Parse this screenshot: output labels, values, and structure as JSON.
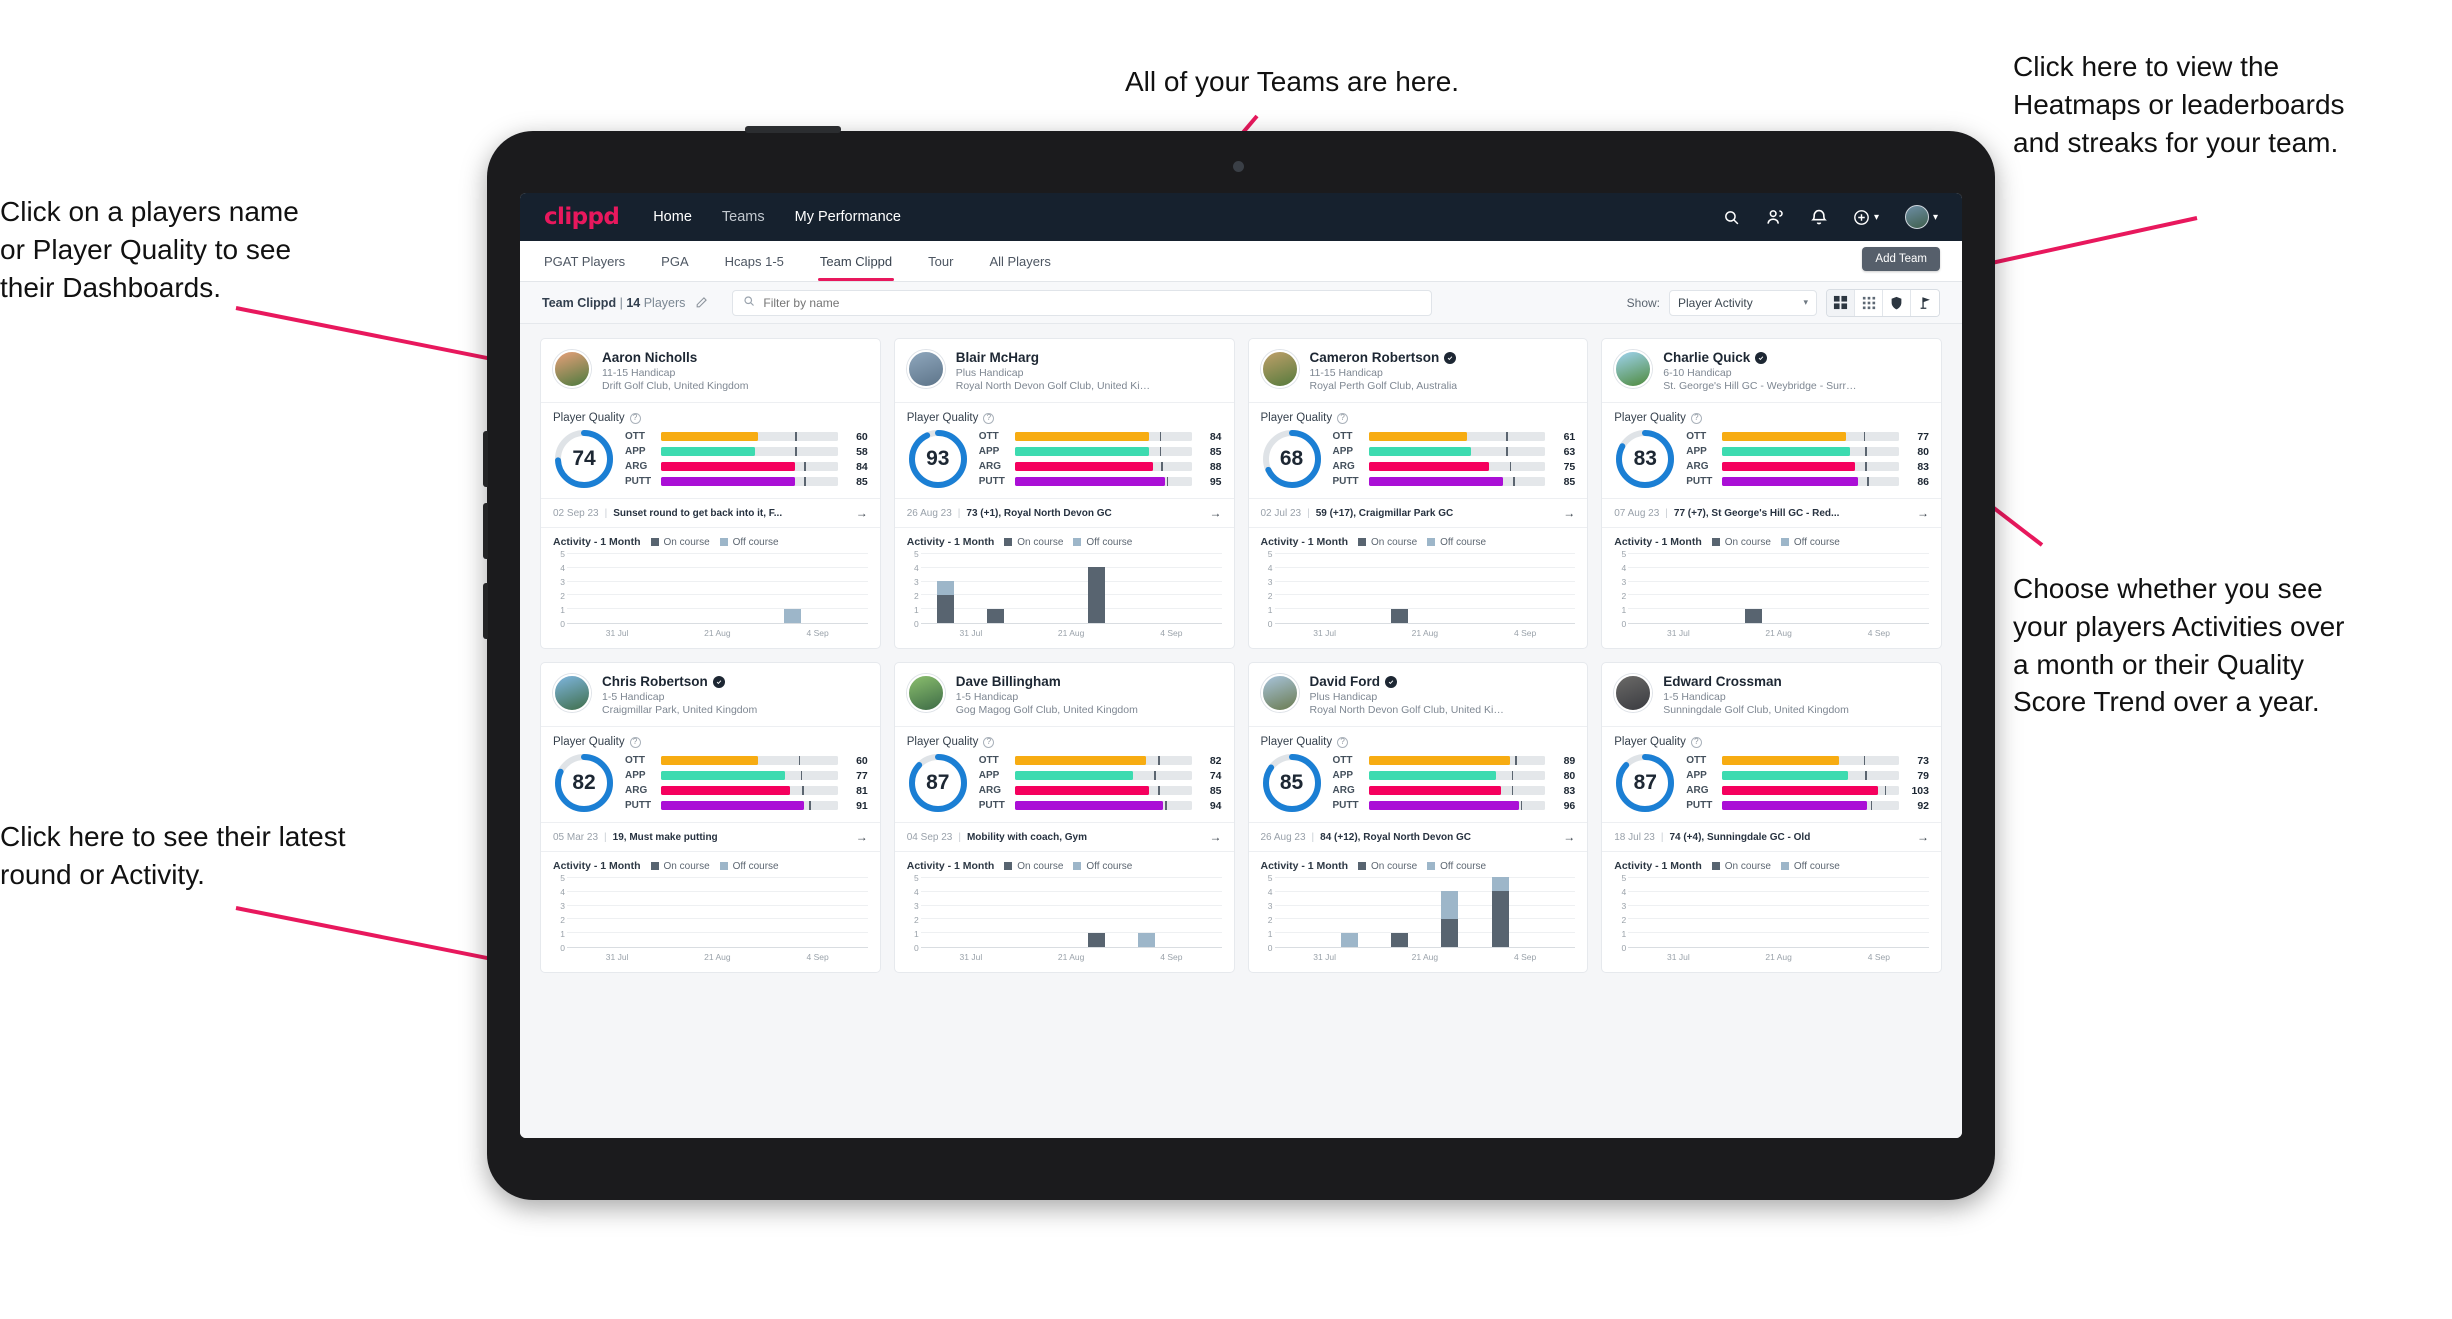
{
  "annotations": [
    {
      "id": "a-players",
      "text": "Click on a players name\nor Player Quality to see\ntheir Dashboards."
    },
    {
      "id": "a-teams",
      "text": "All of your Teams are here."
    },
    {
      "id": "a-heatmaps",
      "text": "Click here to view the\nHeatmaps or leaderboards\nand streaks for your team."
    },
    {
      "id": "a-activity",
      "text": "Choose whether you see\nyour players Activities over\na month or their Quality\nScore Trend over a year."
    },
    {
      "id": "a-latest",
      "text": "Click here to see their latest\nround or Activity."
    }
  ],
  "app": {
    "logo": "clippd",
    "nav": [
      {
        "label": "Home",
        "active": true
      },
      {
        "label": "Teams",
        "active": false
      },
      {
        "label": "My Performance",
        "active": false
      }
    ],
    "header_icons": [
      "search-icon",
      "people-icon",
      "bell-icon",
      "plus-circle-icon",
      "avatar"
    ],
    "tabs": [
      {
        "label": "PGAT Players",
        "active": false
      },
      {
        "label": "PGA",
        "active": false
      },
      {
        "label": "Hcaps 1-5",
        "active": false
      },
      {
        "label": "Team Clippd",
        "active": true
      },
      {
        "label": "Tour",
        "active": false
      },
      {
        "label": "All Players",
        "active": false
      }
    ],
    "add_team_label": "Add Team",
    "toolbar": {
      "team_name": "Team Clippd",
      "player_count": "14",
      "players_word": "Players",
      "separator": "|",
      "search_placeholder": "Filter by name",
      "search_value": "",
      "show_label": "Show:",
      "show_value": "Player Activity",
      "view_buttons": [
        "grid-large-icon",
        "grid-small-icon",
        "shield-icon",
        "flag-icon"
      ],
      "active_view": 0
    },
    "colors": {
      "brand": "#e8185d",
      "header_bg": "#16212e",
      "ott": "#f7ac12",
      "app": "#3ddbb0",
      "arg": "#f5005e",
      "putt": "#aa0fd6",
      "donut": "#1b7fd4",
      "on_course": "#586470",
      "off_course": "#9db6c9"
    },
    "chart_common": {
      "act_title": "Activity - 1 Month",
      "legend": [
        "On course",
        "Off course"
      ],
      "yticks": [
        "5",
        "4",
        "3",
        "2",
        "1",
        "0"
      ],
      "xticks": [
        "31 Jul",
        "21 Aug",
        "4 Sep"
      ],
      "ymax": 5
    },
    "pq_label": "Player Quality",
    "metric_labels": [
      "OTT",
      "APP",
      "ARG",
      "PUTT"
    ]
  },
  "players": [
    {
      "name": "Aaron Nicholls",
      "verified": false,
      "handicap": "11-15 Handicap",
      "club": "Drift Golf Club, United Kingdom",
      "quality": 74,
      "avatar_from": "#e8a07a",
      "avatar_to": "#4c7a3e",
      "metrics": [
        {
          "label": "OTT",
          "value": 60,
          "fill": 55,
          "tick": 76
        },
        {
          "label": "APP",
          "value": 58,
          "fill": 53,
          "tick": 76
        },
        {
          "label": "ARG",
          "value": 84,
          "fill": 76,
          "tick": 81
        },
        {
          "label": "PUTT",
          "value": 85,
          "fill": 76,
          "tick": 81
        }
      ],
      "round": {
        "date": "02 Sep 23",
        "text": "Sunset round to get back into it, F..."
      },
      "activity": [
        {
          "on": 0,
          "off": 0
        },
        {
          "on": 0,
          "off": 0
        },
        {
          "on": 0,
          "off": 0
        },
        {
          "on": 0,
          "off": 0
        },
        {
          "on": 0,
          "off": 1
        },
        {
          "on": 0,
          "off": 0
        }
      ]
    },
    {
      "name": "Blair McHarg",
      "verified": false,
      "handicap": "Plus Handicap",
      "club": "Royal North Devon Golf Club, United Kin...",
      "quality": 93,
      "avatar_from": "#8fa7bd",
      "avatar_to": "#5d7489",
      "metrics": [
        {
          "label": "OTT",
          "value": 84,
          "fill": 76,
          "tick": 82
        },
        {
          "label": "APP",
          "value": 85,
          "fill": 76,
          "tick": 82
        },
        {
          "label": "ARG",
          "value": 88,
          "fill": 78,
          "tick": 83
        },
        {
          "label": "PUTT",
          "value": 95,
          "fill": 85,
          "tick": 86
        }
      ],
      "round": {
        "date": "26 Aug 23",
        "text": "73 (+1), Royal North Devon GC"
      },
      "activity": [
        {
          "on": 2,
          "off": 1
        },
        {
          "on": 1,
          "off": 0
        },
        {
          "on": 0,
          "off": 0
        },
        {
          "on": 4,
          "off": 0
        },
        {
          "on": 0,
          "off": 0
        },
        {
          "on": 0,
          "off": 0
        }
      ]
    },
    {
      "name": "Cameron Robertson",
      "verified": true,
      "handicap": "11-15 Handicap",
      "club": "Royal Perth Golf Club, Australia",
      "quality": 68,
      "avatar_from": "#bfa06a",
      "avatar_to": "#557a3c",
      "metrics": [
        {
          "label": "OTT",
          "value": 61,
          "fill": 56,
          "tick": 78
        },
        {
          "label": "APP",
          "value": 63,
          "fill": 58,
          "tick": 78
        },
        {
          "label": "ARG",
          "value": 75,
          "fill": 68,
          "tick": 80
        },
        {
          "label": "PUTT",
          "value": 85,
          "fill": 76,
          "tick": 82
        }
      ],
      "round": {
        "date": "02 Jul 23",
        "text": "59 (+17), Craigmillar Park GC"
      },
      "activity": [
        {
          "on": 0,
          "off": 0
        },
        {
          "on": 0,
          "off": 0
        },
        {
          "on": 1,
          "off": 0
        },
        {
          "on": 0,
          "off": 0
        },
        {
          "on": 0,
          "off": 0
        },
        {
          "on": 0,
          "off": 0
        }
      ]
    },
    {
      "name": "Charlie Quick",
      "verified": true,
      "handicap": "6-10 Handicap",
      "club": "St. George's Hill GC - Weybridge - Surrey, ...",
      "quality": 83,
      "avatar_from": "#9fd3ef",
      "avatar_to": "#4e8a3c",
      "metrics": [
        {
          "label": "OTT",
          "value": 77,
          "fill": 70,
          "tick": 80
        },
        {
          "label": "APP",
          "value": 80,
          "fill": 72,
          "tick": 81
        },
        {
          "label": "ARG",
          "value": 83,
          "fill": 75,
          "tick": 81
        },
        {
          "label": "PUTT",
          "value": 86,
          "fill": 77,
          "tick": 82
        }
      ],
      "round": {
        "date": "07 Aug 23",
        "text": "77 (+7), St George's Hill GC - Red..."
      },
      "activity": [
        {
          "on": 0,
          "off": 0
        },
        {
          "on": 0,
          "off": 0
        },
        {
          "on": 1,
          "off": 0
        },
        {
          "on": 0,
          "off": 0
        },
        {
          "on": 0,
          "off": 0
        },
        {
          "on": 0,
          "off": 0
        }
      ]
    },
    {
      "name": "Chris Robertson",
      "verified": true,
      "handicap": "1-5 Handicap",
      "club": "Craigmillar Park, United Kingdom",
      "quality": 82,
      "avatar_from": "#7fb6e0",
      "avatar_to": "#3f6e4a",
      "metrics": [
        {
          "label": "OTT",
          "value": 60,
          "fill": 55,
          "tick": 78
        },
        {
          "label": "APP",
          "value": 77,
          "fill": 70,
          "tick": 79
        },
        {
          "label": "ARG",
          "value": 81,
          "fill": 73,
          "tick": 80
        },
        {
          "label": "PUTT",
          "value": 91,
          "fill": 81,
          "tick": 84
        }
      ],
      "round": {
        "date": "05 Mar 23",
        "text": "19, Must make putting"
      },
      "activity": [
        {
          "on": 0,
          "off": 0
        },
        {
          "on": 0,
          "off": 0
        },
        {
          "on": 0,
          "off": 0
        },
        {
          "on": 0,
          "off": 0
        },
        {
          "on": 0,
          "off": 0
        },
        {
          "on": 0,
          "off": 0
        }
      ]
    },
    {
      "name": "Dave Billingham",
      "verified": false,
      "handicap": "1-5 Handicap",
      "club": "Gog Magog Golf Club, United Kingdom",
      "quality": 87,
      "avatar_from": "#8bbf6e",
      "avatar_to": "#3d6b46",
      "metrics": [
        {
          "label": "OTT",
          "value": 82,
          "fill": 74,
          "tick": 81
        },
        {
          "label": "APP",
          "value": 74,
          "fill": 67,
          "tick": 79
        },
        {
          "label": "ARG",
          "value": 85,
          "fill": 76,
          "tick": 81
        },
        {
          "label": "PUTT",
          "value": 94,
          "fill": 84,
          "tick": 85
        }
      ],
      "round": {
        "date": "04 Sep 23",
        "text": "Mobility with coach, Gym"
      },
      "activity": [
        {
          "on": 0,
          "off": 0
        },
        {
          "on": 0,
          "off": 0
        },
        {
          "on": 0,
          "off": 0
        },
        {
          "on": 1,
          "off": 0
        },
        {
          "on": 0,
          "off": 1
        },
        {
          "on": 0,
          "off": 0
        }
      ]
    },
    {
      "name": "David Ford",
      "verified": true,
      "handicap": "Plus Handicap",
      "club": "Royal North Devon Golf Club, United Kin...",
      "quality": 85,
      "avatar_from": "#a8c4dc",
      "avatar_to": "#6a7b50",
      "metrics": [
        {
          "label": "OTT",
          "value": 89,
          "fill": 80,
          "tick": 83
        },
        {
          "label": "APP",
          "value": 80,
          "fill": 72,
          "tick": 81
        },
        {
          "label": "ARG",
          "value": 83,
          "fill": 75,
          "tick": 81
        },
        {
          "label": "PUTT",
          "value": 96,
          "fill": 85,
          "tick": 86
        }
      ],
      "round": {
        "date": "26 Aug 23",
        "text": "84 (+12), Royal North Devon GC"
      },
      "activity": [
        {
          "on": 0,
          "off": 0
        },
        {
          "on": 0,
          "off": 1
        },
        {
          "on": 1,
          "off": 0
        },
        {
          "on": 2,
          "off": 2
        },
        {
          "on": 4,
          "off": 1
        },
        {
          "on": 0,
          "off": 0
        }
      ]
    },
    {
      "name": "Edward Crossman",
      "verified": false,
      "handicap": "1-5 Handicap",
      "club": "Sunningdale Golf Club, United Kingdom",
      "quality": 87,
      "avatar_from": "#6b6a68",
      "avatar_to": "#3a3b40",
      "metrics": [
        {
          "label": "OTT",
          "value": 73,
          "fill": 66,
          "tick": 80
        },
        {
          "label": "APP",
          "value": 79,
          "fill": 71,
          "tick": 81
        },
        {
          "label": "ARG",
          "value": 103,
          "fill": 88,
          "tick": 92
        },
        {
          "label": "PUTT",
          "value": 92,
          "fill": 82,
          "tick": 84
        }
      ],
      "round": {
        "date": "18 Jul 23",
        "text": "74 (+4), Sunningdale GC - Old"
      },
      "activity": [
        {
          "on": 0,
          "off": 0
        },
        {
          "on": 0,
          "off": 0
        },
        {
          "on": 0,
          "off": 0
        },
        {
          "on": 0,
          "off": 0
        },
        {
          "on": 0,
          "off": 0
        },
        {
          "on": 0,
          "off": 0
        }
      ]
    }
  ]
}
